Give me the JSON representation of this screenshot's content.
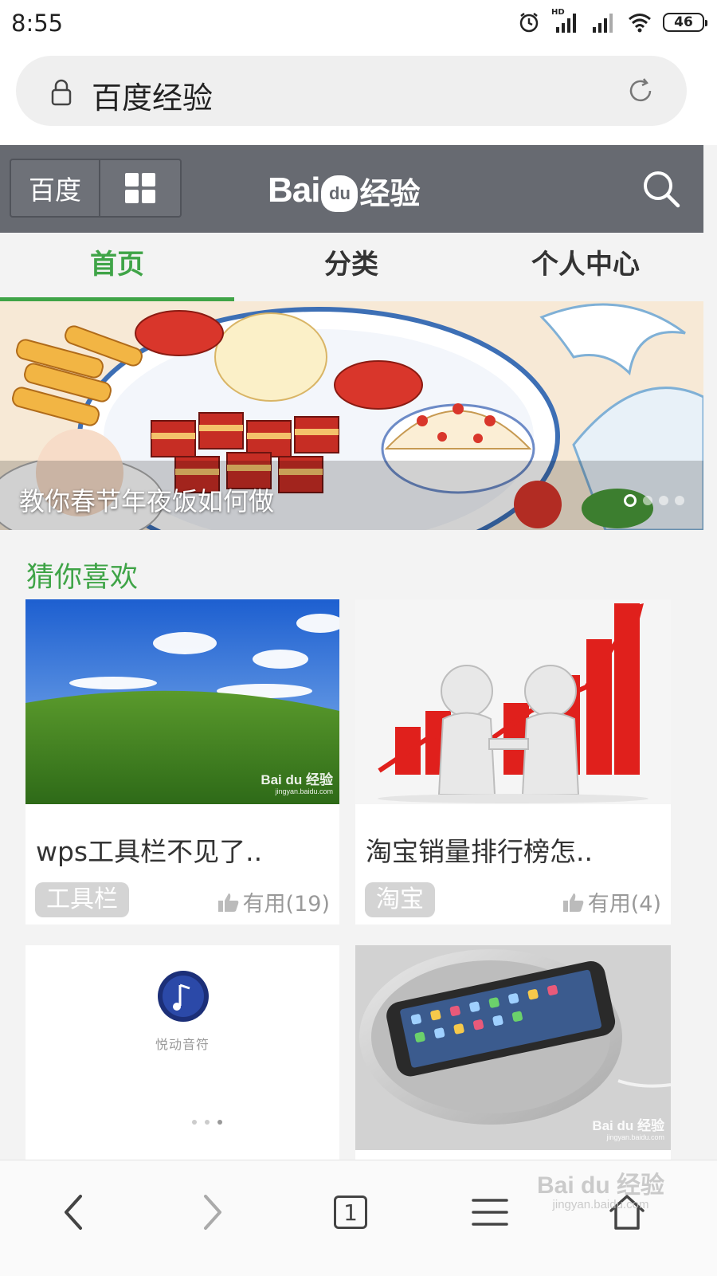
{
  "status_bar": {
    "time": "8:55",
    "battery": "46",
    "signal_label": "HD"
  },
  "address_bar": {
    "text": "百度经验"
  },
  "header": {
    "baidu_label": "百度",
    "logo": {
      "bai": "Bai",
      "du": "du",
      "jingyan": "经验"
    }
  },
  "tabs": [
    {
      "label": "首页",
      "active": true
    },
    {
      "label": "分类",
      "active": false
    },
    {
      "label": "个人中心",
      "active": false
    }
  ],
  "banner": {
    "caption": "教你春节年夜饭如何做",
    "slide_count": 4,
    "current_slide": 1
  },
  "section": {
    "title": "猜你喜欢"
  },
  "cards": [
    {
      "title": "wps工具栏不见了..",
      "tag": "工具栏",
      "useful": "有用(19)"
    },
    {
      "title": "淘宝销量排行榜怎..",
      "tag": "淘宝",
      "useful": "有用(4)"
    },
    {
      "image_text": "悦动音符"
    },
    {}
  ],
  "watermark": {
    "brand": "Bai du 经验",
    "url": "jingyan.baidu.com"
  },
  "toolbar": {
    "tab_count": "1"
  },
  "colors": {
    "accent_green": "#3fa447",
    "header_gray": "#676a71"
  }
}
